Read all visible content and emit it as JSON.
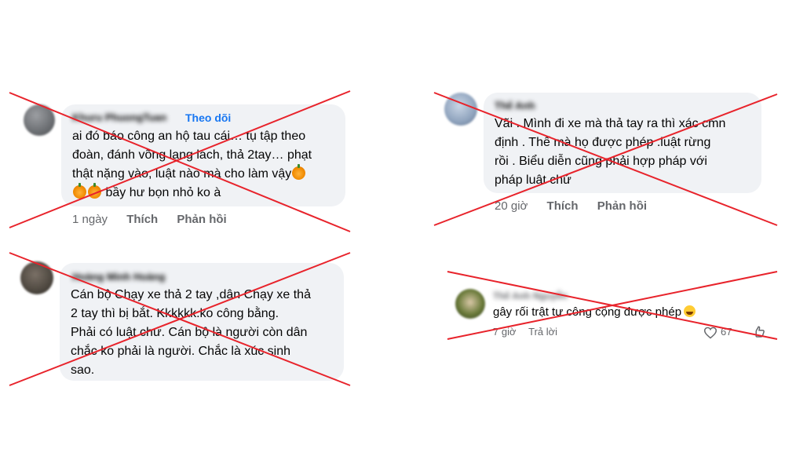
{
  "comments": [
    {
      "author": "Khuru PhuongTuan",
      "follow_label": "Theo dõi",
      "lines": [
        "ai đó báo công an hộ tau cái… tụ tập theo",
        "đoàn, đánh võng lạng lách, thả 2tay… phạt",
        "thật nặng vào, luật nào mà cho làm vậy",
        "bầy hư bọn nhỏ ko à"
      ],
      "time": "1 ngày",
      "like_label": "Thích",
      "reply_label": "Phản hồi"
    },
    {
      "author": "Thế Anh",
      "lines": [
        "Vãi . Mình đi xe mà thả tay ra thì xác cmn",
        "định . Thế mà họ được phép .luật rừng",
        "rồi . Biểu diễn cũng phải hợp pháp với",
        "pháp luật chứ"
      ],
      "time": "20 giờ",
      "like_label": "Thích",
      "reply_label": "Phản hồi"
    },
    {
      "author": "Hoàng Minh Hoàng",
      "lines": [
        "Cán bộ Chạy xe thả 2 tay ,dân Chạy xe thả",
        "2 tay thì bị bắt. Kkkkkk.ko công bằng.",
        "Phải có luật chứ. Cán bộ là người còn dân",
        "chắc ko phải là người. Chắc là xúc sinh",
        "sao."
      ]
    },
    {
      "author": "Thế Anh Nguyễn",
      "lines": [
        "gây rối trật tự công cộng được phép"
      ],
      "time": "7 giờ",
      "reply_label": "Trả lời",
      "like_count": "67"
    }
  ],
  "icons": {
    "emoji": "pumpkin-emoji",
    "laugh": "laughing-emoji",
    "heart": "heart-icon",
    "more": "more-icon"
  },
  "colors": {
    "cross": "#e8232b",
    "link": "#1877f2",
    "bubble": "#f0f2f5",
    "meta": "#65676b"
  }
}
